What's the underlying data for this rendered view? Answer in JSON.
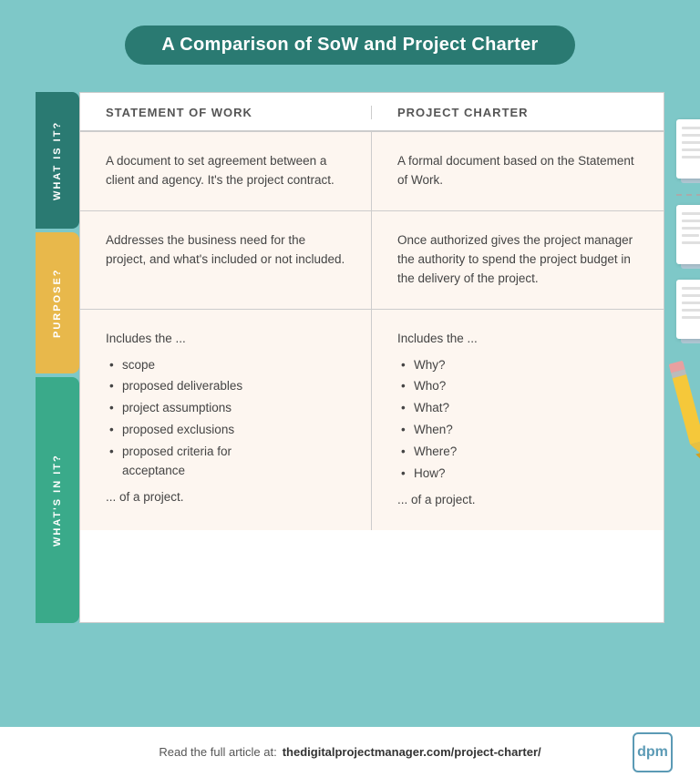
{
  "title": "A Comparison of SoW and Project Charter",
  "columns": {
    "col1": "STATEMENT OF WORK",
    "col2": "PROJECT CHARTER"
  },
  "rows": {
    "row1": {
      "label": "WHAT IS IT?",
      "col1": "A document to set agreement between a client and agency. It's the project contract.",
      "col2": "A formal document based on the Statement of Work."
    },
    "row2": {
      "label": "PURPOSE?",
      "col1": "Addresses the business need for the project, and what's included or not included.",
      "col2": "Once authorized gives the project manager the authority to spend the project budget in the delivery of the project."
    },
    "row3": {
      "label": "WHAT'S IN IT?",
      "col1_intro": "Includes the ...",
      "col1_items": [
        "scope",
        "proposed deliverables",
        "project assumptions",
        "proposed exclusions",
        "proposed criteria for acceptance"
      ],
      "col1_outro": "... of a project.",
      "col2_intro": "Includes the ...",
      "col2_items": [
        "Why?",
        "Who?",
        "What?",
        "When?",
        "Where?",
        "How?"
      ],
      "col2_outro": "... of a project."
    }
  },
  "footer": {
    "read_text": "Read the full article at:",
    "link_text": "thedigitalprojectmanager.com/project-charter/",
    "badge": "dpm"
  }
}
